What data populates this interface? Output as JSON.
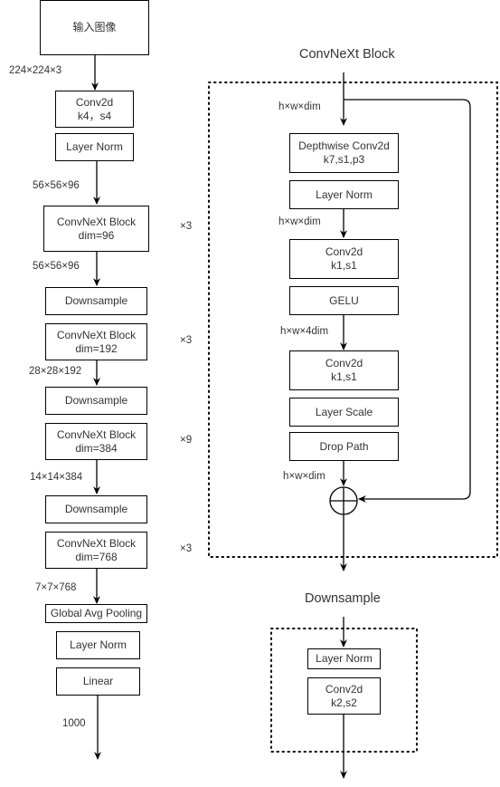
{
  "main_flow": {
    "input": "输入图像",
    "stem_conv": "Conv2d\nk4，s4",
    "stem_norm": "Layer Norm",
    "stages": [
      {
        "block": "ConvNeXt Block\ndim=96",
        "repeat": "×3"
      },
      {
        "block": "ConvNeXt Block\ndim=192",
        "repeat": "×3"
      },
      {
        "block": "ConvNeXt Block\ndim=384",
        "repeat": "×9"
      },
      {
        "block": "ConvNeXt Block\ndim=768",
        "repeat": "×3"
      }
    ],
    "downsample": "Downsample",
    "pool": "Global Avg Pooling",
    "head_norm": "Layer Norm",
    "linear": "Linear",
    "shapes": {
      "input": "224×224×3",
      "after_stem": "56×56×96",
      "after_stage1": "56×56×96",
      "after_stage2": "28×28×192",
      "after_stage3": "14×14×384",
      "after_stage4": "7×7×768",
      "output": "1000"
    }
  },
  "convnext_block": {
    "title": "ConvNeXt Block",
    "layers": {
      "dwconv": "Depthwise Conv2d\nk7,s1,p3",
      "norm": "Layer Norm",
      "pw1": "Conv2d\nk1,s1",
      "act": "GELU",
      "pw2": "Conv2d\nk1,s1",
      "scale": "Layer Scale",
      "drop": "Drop Path"
    },
    "shapes": {
      "input": "h×w×dim",
      "after_norm": "h×w×dim",
      "after_gelu": "h×w×4dim",
      "before_add": "h×w×dim"
    }
  },
  "downsample_block": {
    "title": "Downsample",
    "layers": {
      "norm": "Layer Norm",
      "conv": "Conv2d\nk2,s2"
    }
  }
}
